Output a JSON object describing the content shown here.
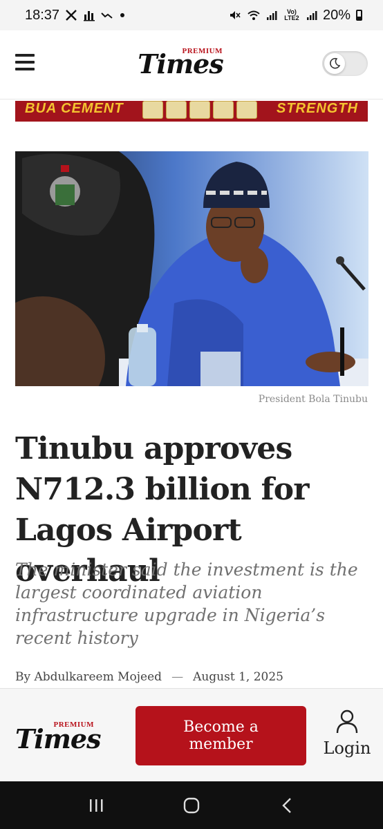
{
  "status_bar": {
    "time": "18:37",
    "left_icons": [
      "x-icon",
      "chart-icon",
      "trend-icon",
      "dot-icon"
    ],
    "network_label": "Vo) LTE2",
    "battery": "20%"
  },
  "header": {
    "logo_premium": "PREMIUM",
    "logo_times": "Times",
    "menu_icon": "hamburger-icon",
    "theme_toggle_icon": "moon-icon"
  },
  "ad_banner": {
    "left_text": "BUA CEMENT",
    "right_text": "STRENGTH"
  },
  "article": {
    "image_caption": "President Bola Tinubu",
    "headline": "Tinubu approves N712.3 billion for Lagos Airport overhaul",
    "subheadline": "The minister said the investment is the largest coordinated aviation infrastructure upgrade in Nigeria’s recent history",
    "author": "By Abdulkareem Mojeed",
    "separator": "—",
    "date": "August 1, 2025"
  },
  "member_bar": {
    "logo_premium": "PREMIUM",
    "logo_times": "Times",
    "button_label": "Become a member",
    "login_label": "Login",
    "login_icon": "user-icon"
  },
  "nav_bar": {
    "buttons": [
      "recents-icon",
      "home-icon",
      "back-icon"
    ]
  },
  "colors": {
    "brand_red": "#b5121b",
    "ad_gold": "#f4c430"
  }
}
